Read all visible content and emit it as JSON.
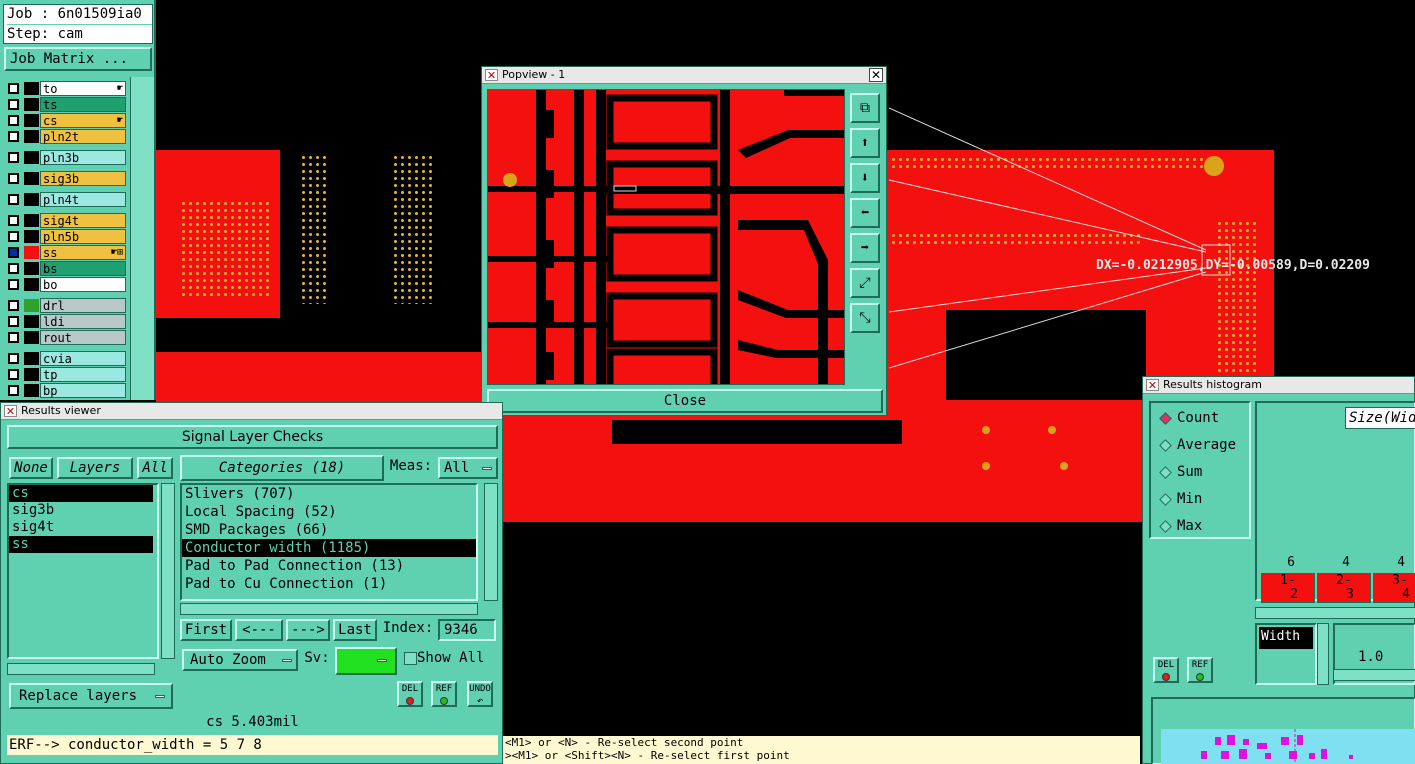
{
  "job_panel": {
    "job_label": "Job : 6n01509ia0",
    "step_label": "Step: cam",
    "job_matrix_label": "Job Matrix ...",
    "layers": [
      {
        "name": "to",
        "color": "#ffffff",
        "swatch": "#000000",
        "checked": false,
        "mark": "☛"
      },
      {
        "name": "ts",
        "color": "#20a070",
        "swatch": "#000000",
        "checked": false,
        "mark": ""
      },
      {
        "name": "cs",
        "color": "#f0c040",
        "swatch": "#000000",
        "checked": false,
        "mark": "☛"
      },
      {
        "name": "pln2t",
        "color": "#f0c040",
        "swatch": "#000000",
        "checked": false,
        "mark": ""
      },
      {
        "name": "pln3b",
        "color": "#9be8e0",
        "swatch": "#000000",
        "checked": false,
        "mark": ""
      },
      {
        "name": "sig3b",
        "color": "#f0c040",
        "swatch": "#000000",
        "checked": false,
        "mark": ""
      },
      {
        "name": "pln4t",
        "color": "#9be8e0",
        "swatch": "#000000",
        "checked": false,
        "mark": ""
      },
      {
        "name": "sig4t",
        "color": "#f0c040",
        "swatch": "#000000",
        "checked": false,
        "mark": ""
      },
      {
        "name": "pln5b",
        "color": "#f0c040",
        "swatch": "#000000",
        "checked": false,
        "mark": ""
      },
      {
        "name": "ss",
        "color": "#f0c040",
        "swatch": "#f51010",
        "checked": true,
        "mark": "☛⊞"
      },
      {
        "name": "bs",
        "color": "#20a070",
        "swatch": "#000000",
        "checked": false,
        "mark": ""
      },
      {
        "name": "bo",
        "color": "#ffffff",
        "swatch": "#000000",
        "checked": false,
        "mark": ""
      },
      {
        "name": "drl",
        "color": "#b8c8c8",
        "swatch": "#30a030",
        "checked": false,
        "mark": ""
      },
      {
        "name": "ldi",
        "color": "#b8c8c8",
        "swatch": "#000000",
        "checked": false,
        "mark": ""
      },
      {
        "name": "rout",
        "color": "#b8c8c8",
        "swatch": "#000000",
        "checked": false,
        "mark": ""
      },
      {
        "name": "cvia",
        "color": "#9be8e0",
        "swatch": "#000000",
        "checked": false,
        "mark": ""
      },
      {
        "name": "tp",
        "color": "#9be8e0",
        "swatch": "#000000",
        "checked": false,
        "mark": ""
      },
      {
        "name": "bp",
        "color": "#9be8e0",
        "swatch": "#000000",
        "checked": false,
        "mark": ""
      }
    ]
  },
  "canvas": {
    "measurement": "DX=-0.0212905,DY=-0.00589,D=0.02209",
    "status_line1": "<M1> or <N> - Re-select second point",
    "status_line2": "><M1> or <Shift><N> - Re-select first point"
  },
  "popview": {
    "title": "Popview - 1",
    "close_label": "Close",
    "tools": [
      "zoom-fit-icon",
      "pan-up-icon",
      "pan-down-icon",
      "pan-left-icon",
      "pan-right-icon",
      "zoom-in-icon",
      "zoom-out-icon"
    ],
    "tool_glyphs": [
      "⧉",
      "⬆",
      "⬇",
      "⬅",
      "➡",
      "⤢",
      "⤡"
    ]
  },
  "results_viewer": {
    "title": "Results viewer",
    "heading": "Signal Layer Checks",
    "none_label": "None",
    "layers_label": "Layers",
    "all_label": "All",
    "categories_label": "Categories (18)",
    "meas_label": "Meas:",
    "meas_value": "All",
    "layer_items": [
      {
        "name": "cs",
        "selected": true
      },
      {
        "name": "sig3b",
        "selected": false
      },
      {
        "name": "sig4t",
        "selected": false
      },
      {
        "name": "ss",
        "selected": true
      }
    ],
    "categories": [
      {
        "name": "Slivers (707)",
        "selected": false
      },
      {
        "name": "Local Spacing (52)",
        "selected": false
      },
      {
        "name": "SMD Packages (66)",
        "selected": false
      },
      {
        "name": "Conductor width (1185)",
        "selected": true
      },
      {
        "name": "Pad to Pad Connection (13)",
        "selected": false
      },
      {
        "name": "Pad to Cu Connection (1)",
        "selected": false
      }
    ],
    "first_label": "First",
    "prev_label": "<---",
    "next_label": "--->",
    "last_label": "Last",
    "index_label": "Index:",
    "index_value": "9346",
    "zoom_label": "Auto Zoom",
    "sv_label": "Sv:",
    "sv_color": "#20e020",
    "show_all_label": "Show All",
    "replace_layers_label": "Replace layers",
    "del_label": "DEL",
    "ref_label": "REF",
    "undo_label": "UNDO",
    "status_value": "cs 5.403mil",
    "command_text": "ERF--> conductor_width = 5 7 8"
  },
  "histogram": {
    "title": "Results histogram",
    "modes": [
      {
        "label": "Count",
        "on": true
      },
      {
        "label": "Average",
        "on": false
      },
      {
        "label": "Sum",
        "on": false
      },
      {
        "label": "Min",
        "on": false
      },
      {
        "label": "Max",
        "on": false
      }
    ],
    "plot_title": "Size(Wid",
    "counts": [
      "6",
      "4",
      "4"
    ],
    "bins": [
      {
        "top": "1-",
        "bottom": "2"
      },
      {
        "top": "2-",
        "bottom": "3"
      },
      {
        "top": "3-",
        "bottom": "4"
      }
    ],
    "width_label": "Width",
    "scale_value": "1.0",
    "del_label": "DEL",
    "ref_label": "REF"
  }
}
